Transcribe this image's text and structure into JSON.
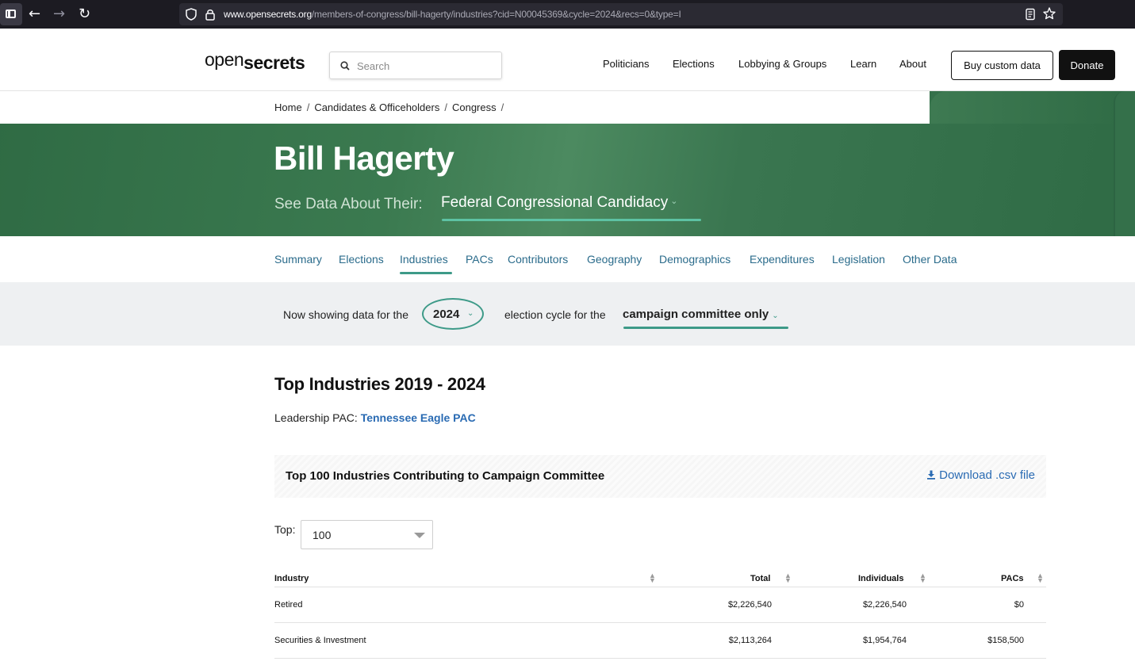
{
  "browser": {
    "url_domain": "www.opensecrets.org",
    "url_path": "/members-of-congress/bill-hagerty/industries?cid=N00045369&cycle=2024&recs=0&type=I"
  },
  "header": {
    "logo_open": "open",
    "logo_secrets": "secrets",
    "search_placeholder": "Search",
    "nav": [
      "Politicians",
      "Elections",
      "Lobbying & Groups",
      "Learn",
      "About"
    ],
    "buy_label": "Buy custom data",
    "donate_label": "Donate"
  },
  "breadcrumb": [
    "Home",
    "Candidates & Officeholders",
    "Congress"
  ],
  "hero": {
    "name": "Bill Hagerty",
    "see_label": "See Data About Their:",
    "selected_view": "Federal Congressional Candidacy"
  },
  "tabs": [
    "Summary",
    "Elections",
    "Industries",
    "PACs",
    "Contributors",
    "Geography",
    "Demographics",
    "Expenditures",
    "Legislation",
    "Other Data"
  ],
  "active_tab": "Industries",
  "cycle": {
    "prefix": "Now showing data for the",
    "year": "2024",
    "middle": "election cycle for the",
    "committee": "campaign committee only"
  },
  "content": {
    "title": "Top Industries 2019 - 2024",
    "pac_label": "Leadership PAC:",
    "pac_name": "Tennessee Eagle PAC",
    "table_title": "Top 100 Industries Contributing to Campaign Committee",
    "download_label": "Download .csv file",
    "top_label": "Top:",
    "top_value": "100"
  },
  "table": {
    "columns": [
      "Industry",
      "Total",
      "Individuals",
      "PACs"
    ],
    "rows": [
      {
        "industry": "Retired",
        "total": "$2,226,540",
        "individuals": "$2,226,540",
        "pacs": "$0"
      },
      {
        "industry": "Securities & Investment",
        "total": "$2,113,264",
        "individuals": "$1,954,764",
        "pacs": "$158,500"
      }
    ]
  },
  "colors": {
    "hero_green": "#3b7a50",
    "accent_teal": "#3d9a88",
    "link_blue": "#2a6bb3",
    "tab_blue": "#2a6b8b"
  }
}
